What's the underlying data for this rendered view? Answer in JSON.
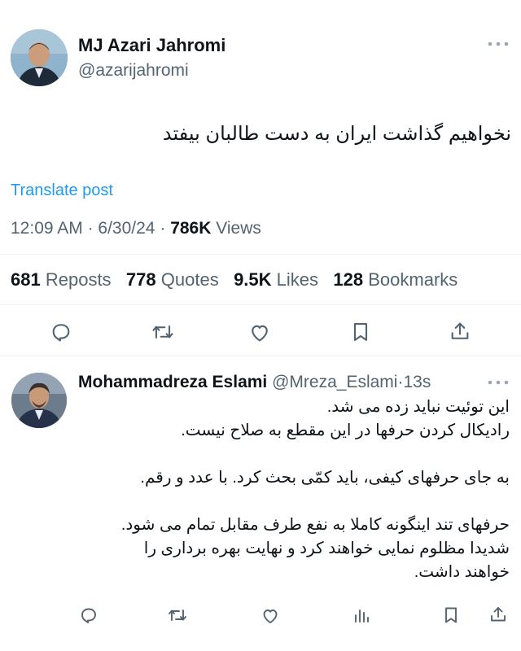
{
  "main_post": {
    "author_name": "MJ Azari Jahromi",
    "author_handle": "@azarijahromi",
    "text": "نخواهیم گذاشت ایران به دست طالبان بیفتد",
    "translate_label": "Translate post",
    "time": "12:09 AM",
    "sep1": "·",
    "date": "6/30/24",
    "sep2": "·",
    "views_count": "786K",
    "views_label": "Views",
    "more_icon": "more-horizontal-icon"
  },
  "stats": [
    {
      "count": "681",
      "label": "Reposts"
    },
    {
      "count": "778",
      "label": "Quotes"
    },
    {
      "count": "9.5K",
      "label": "Likes"
    },
    {
      "count": "128",
      "label": "Bookmarks"
    }
  ],
  "main_actions": [
    "reply-icon",
    "repost-icon",
    "like-icon",
    "bookmark-icon",
    "share-icon"
  ],
  "reply": {
    "author_name": "Mohammadreza Eslami",
    "author_handle": "@Mreza_Eslami",
    "sep": "·",
    "time": "13s",
    "lines": [
      "این توئیت نباید زده می شد.",
      "رادیکال کردن حرفها در این مقطع به صلاح نیست.",
      "",
      "به جای حرفهای کیفی، باید کمّی بحث کرد. با عدد و رقم.",
      "",
      "حرفهای تند اینگونه کاملا به نفع طرف مقابل تمام می شود.",
      "شدیدا مظلوم نمایی خواهند کرد و نهایت بهره برداری را",
      "خواهند داشت."
    ]
  },
  "reply_actions": [
    "reply-icon",
    "repost-icon",
    "like-icon",
    "views-icon",
    "bookmark-icon",
    "share-icon"
  ]
}
